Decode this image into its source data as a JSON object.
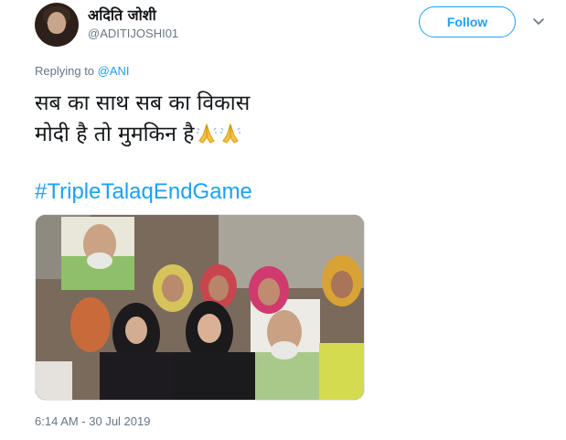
{
  "user": {
    "display_name": "अदिति जोशी",
    "handle": "@ADITIJOSHI01",
    "avatar_icon": "profile-photo"
  },
  "follow_label": "Follow",
  "reply": {
    "prefix": "Replying to ",
    "target": "@ANI"
  },
  "tweet": {
    "line1": "सब का साथ सब का विकास",
    "line2": "मोदी है तो मुमकिन है",
    "emoji": "folded-hands-icon",
    "hashtag": "#TripleTalaqEndGame"
  },
  "media": {
    "description_icon": "photo"
  },
  "timestamp": "6:14 AM - 30 Jul 2019",
  "colors": {
    "accent": "#1da1f2",
    "secondary_text": "#657786",
    "primary_text": "#14171a"
  }
}
